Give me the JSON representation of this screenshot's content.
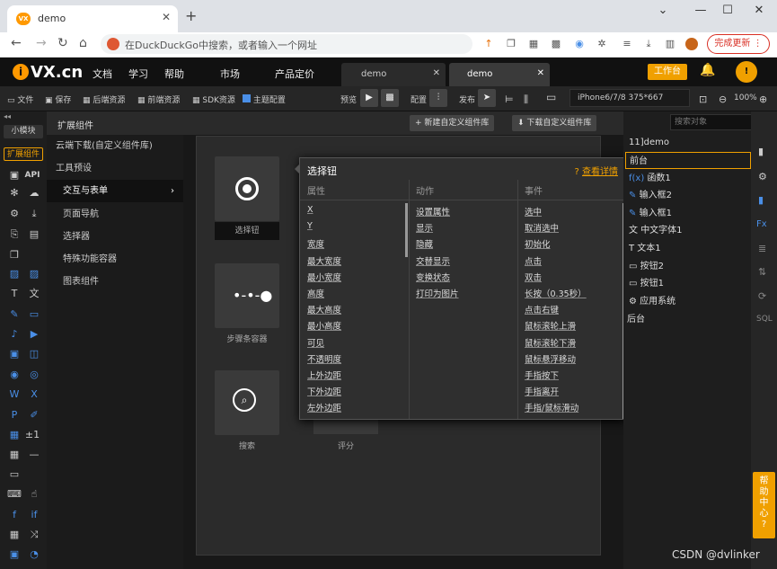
{
  "browser": {
    "tab_title": "demo",
    "url_placeholder": "在DuckDuckGo中搜索，或者输入一个网址",
    "update_label": "完成更新"
  },
  "ivx": {
    "logo": "VX.cn",
    "menu": [
      "文档",
      "学习",
      "帮助",
      "市场",
      "产品定价"
    ],
    "doc_tabs": [
      "demo",
      "demo"
    ],
    "workbench": "工作台"
  },
  "toolbar": {
    "items": [
      "文件",
      "保存",
      "后端资源",
      "前端资源",
      "SDK资源",
      "主题配置"
    ],
    "preview": "预览",
    "config": "配置",
    "publish": "发布",
    "device": "iPhone6/7/8 375*667",
    "zoom": "100%"
  },
  "left": {
    "small_module": "小模块",
    "ext_component": "扩展组件",
    "api": "API"
  },
  "categories": {
    "header": "扩展组件",
    "items": [
      "云端下载(自定义组件库)",
      "工具预设",
      "交互与表单",
      "页面导航",
      "选择器",
      "特殊功能容器",
      "图表组件"
    ],
    "selected_index": 2,
    "new_lib": "新建自定义组件库",
    "download_lib": "下载自定义组件库"
  },
  "tiles": [
    {
      "label": "选择钮"
    },
    {
      "label": "步骤条容器"
    },
    {
      "label": "搜索"
    },
    {
      "label": "评分"
    }
  ],
  "popup": {
    "title": "选择钮",
    "more": "查看详情",
    "col_headers": [
      "属性",
      "动作",
      "事件"
    ],
    "props": [
      "X",
      "Y",
      "宽度",
      "最大宽度",
      "最小宽度",
      "高度",
      "最大高度",
      "最小高度",
      "可见",
      "不透明度",
      "上外边距",
      "下外边距",
      "左外边距"
    ],
    "actions": [
      "设置属性",
      "显示",
      "隐藏",
      "交替显示",
      "变换状态",
      "打印为图片"
    ],
    "events": [
      "选中",
      "取消选中",
      "初始化",
      "点击",
      "双击",
      "长按（0.35秒）",
      "点击右键",
      "鼠标滚轮上滑",
      "鼠标滚轮下滑",
      "鼠标悬浮移动",
      "手指按下",
      "手指离开",
      "手指/鼠标滑动"
    ]
  },
  "tree": {
    "search_placeholder": "搜索对象",
    "root": "11]demo",
    "nodes": [
      "前台",
      "函数1",
      "输入框2",
      "输入框1",
      "中文字体1",
      "文本1",
      "按钮2",
      "按钮1",
      "应用系统",
      "后台"
    ]
  },
  "help": "帮助中心",
  "watermark": "CSDN @dvlinker",
  "colors": {
    "accent": "#f0a000",
    "bg": "#202124"
  }
}
